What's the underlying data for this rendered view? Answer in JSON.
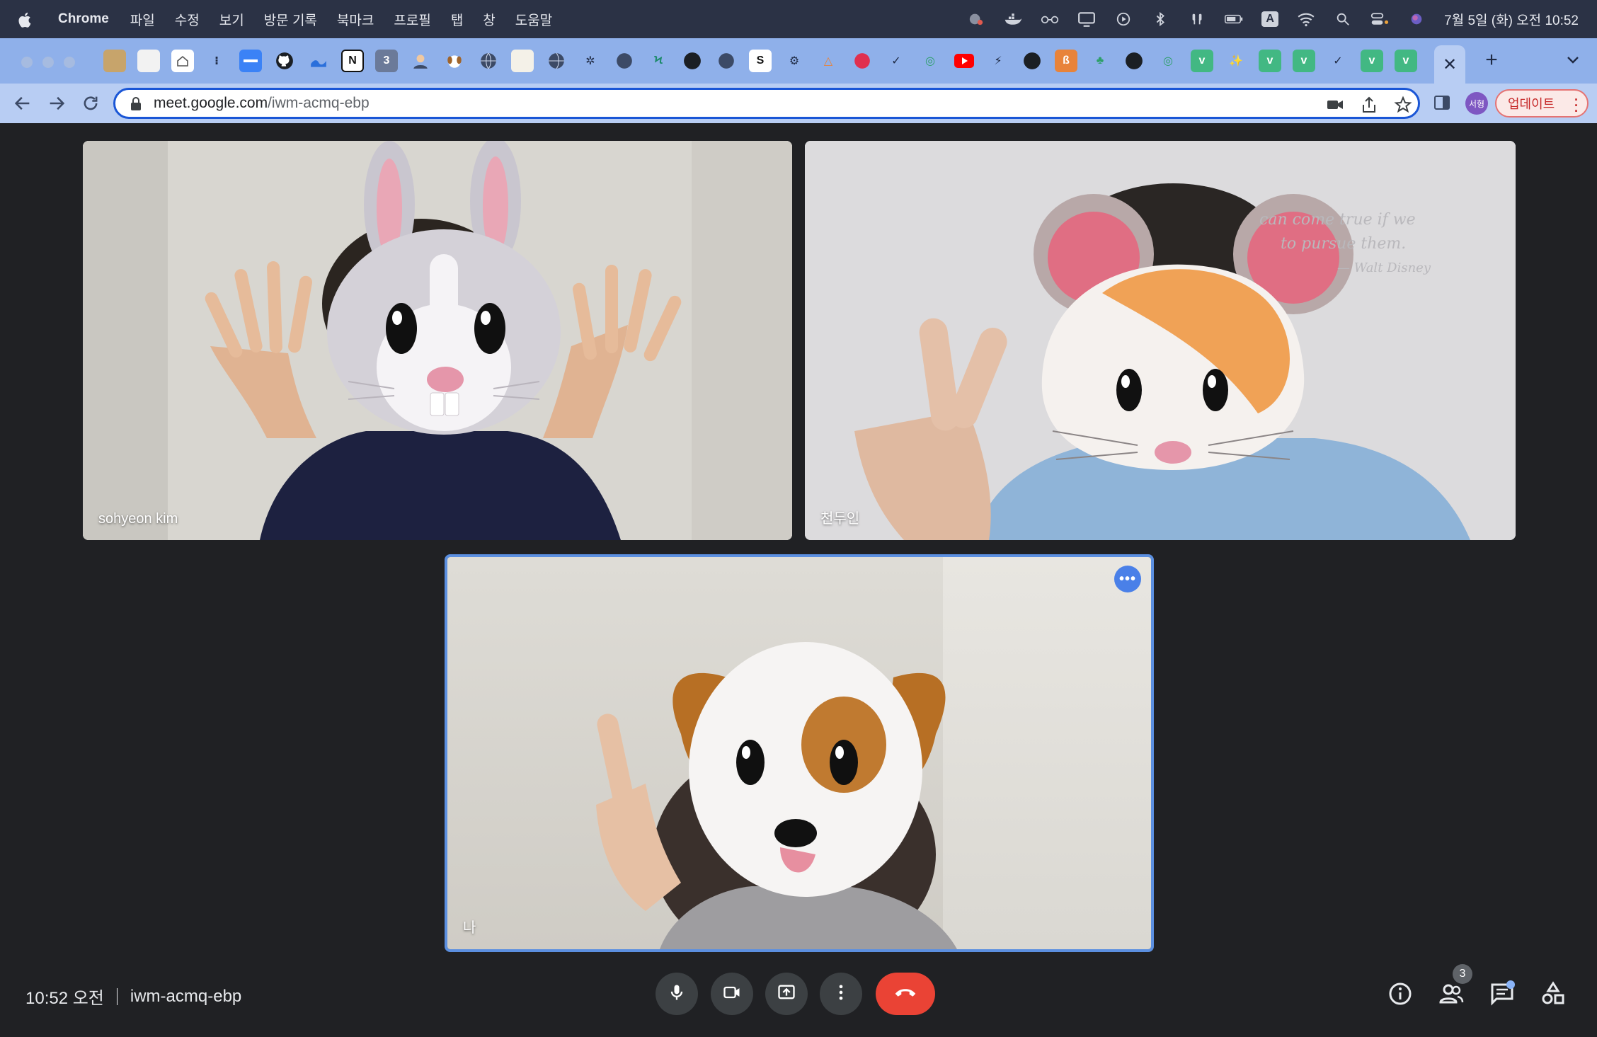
{
  "menubar": {
    "app_name": "Chrome",
    "items": [
      "파일",
      "수정",
      "보기",
      "방문 기록",
      "북마크",
      "프로필",
      "탭",
      "창",
      "도움말"
    ],
    "clock": "7월 5일 (화) 오전 10:52",
    "input_source": "A"
  },
  "browser": {
    "url_host": "meet.google.com",
    "url_path": "/iwm-acmq-ebp",
    "profile_label": "서형",
    "update_label": "업데이트",
    "pinned_tab_labels": [
      "3",
      "S"
    ],
    "active_tab_icon": "close-icon"
  },
  "meet": {
    "participants": [
      {
        "name": "sohyeon kim",
        "effect": "rabbit"
      },
      {
        "name": "천두인",
        "effect": "hamster"
      },
      {
        "name": "나",
        "effect": "dog"
      }
    ],
    "background_quote": [
      "can come true if we",
      "to pursue them.",
      "— Walt Disney"
    ],
    "time": "10:52 오전",
    "meeting_code": "iwm-acmq-ebp",
    "participant_count": "3",
    "controls": [
      "microphone-icon",
      "camera-icon",
      "present-icon",
      "more-options-icon",
      "hang-up-icon"
    ],
    "side_controls": [
      "info-icon",
      "people-icon",
      "chat-icon",
      "activities-icon"
    ],
    "colors": {
      "hangup": "#ea4335",
      "active_border": "#5b8fe0",
      "background": "#202124"
    }
  }
}
